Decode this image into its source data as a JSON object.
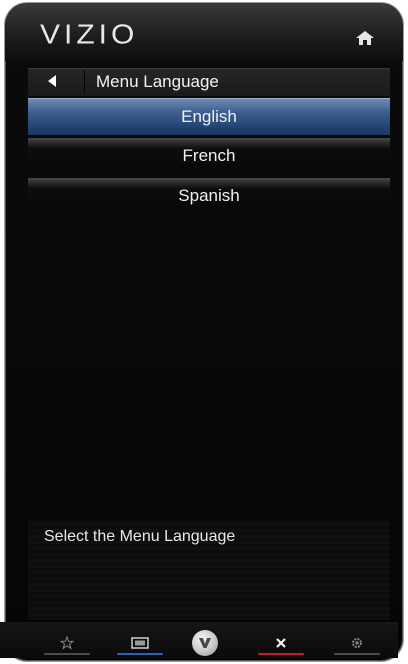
{
  "header": {
    "logo": "VIZIO",
    "home_icon": "home-icon"
  },
  "menu": {
    "back_icon": "back-arrow-icon",
    "title": "Menu Language",
    "items": [
      {
        "label": "English",
        "selected": true
      },
      {
        "label": "French",
        "selected": false
      },
      {
        "label": "Spanish",
        "selected": false
      }
    ]
  },
  "help": {
    "text": "Select the Menu Language"
  },
  "bottom_nav": {
    "icons": [
      "star-icon",
      "input-icon",
      "vizio-v-icon",
      "close-icon",
      "settings-icon"
    ],
    "underline_colors": {
      "input": "#2f5fb0",
      "close": "#c21a3a",
      "default": "#4a4a4a"
    }
  },
  "colors": {
    "selected_item": "#3f5f90",
    "background": "#050505",
    "text": "#f0f0f0"
  }
}
